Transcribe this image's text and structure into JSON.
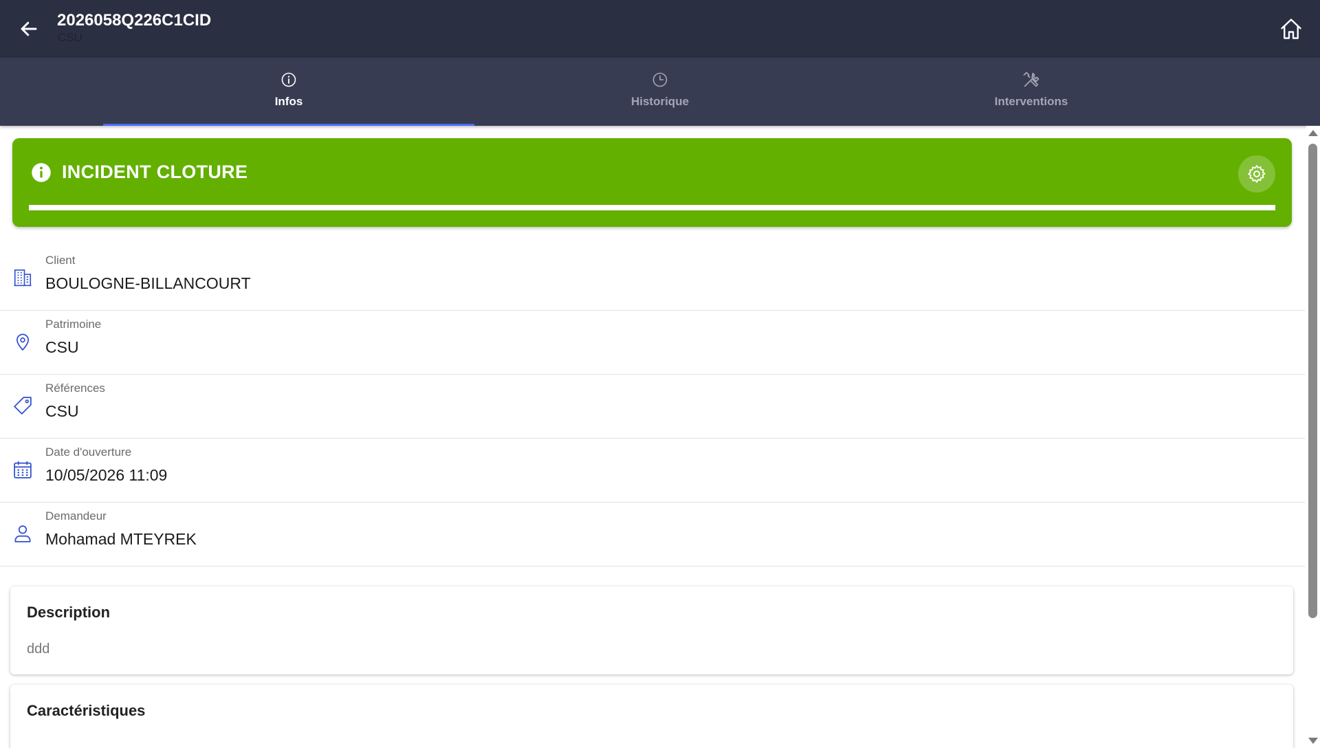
{
  "header": {
    "title": "2026058Q226C1CID",
    "subtitle": "CSU"
  },
  "tabs": [
    {
      "label": "Infos",
      "icon": "info-icon",
      "active": true
    },
    {
      "label": "Historique",
      "icon": "clock-icon",
      "active": false
    },
    {
      "label": "Interventions",
      "icon": "tools-icon",
      "active": false
    }
  ],
  "status": {
    "title": "INCIDENT CLOTURE",
    "color": "#63b000",
    "progress": 1.0
  },
  "fields": [
    {
      "label": "Client",
      "value": "BOULOGNE-BILLANCOURT",
      "icon": "building-icon"
    },
    {
      "label": "Patrimoine",
      "value": "CSU",
      "icon": "location-pin-icon"
    },
    {
      "label": "Références",
      "value": "CSU",
      "icon": "tag-icon"
    },
    {
      "label": "Date d'ouverture",
      "value": "10/05/2026 11:09",
      "icon": "calendar-icon"
    },
    {
      "label": "Demandeur",
      "value": "Mohamad MTEYREK",
      "icon": "person-icon"
    }
  ],
  "description": {
    "title": "Description",
    "text": "ddd"
  },
  "characteristics": {
    "title": "Caractéristiques"
  },
  "colors": {
    "topbar": "#2b2f42",
    "tabbar": "#383c53",
    "accent": "#4a6cf7",
    "icon_blue": "#2f4fd1"
  }
}
